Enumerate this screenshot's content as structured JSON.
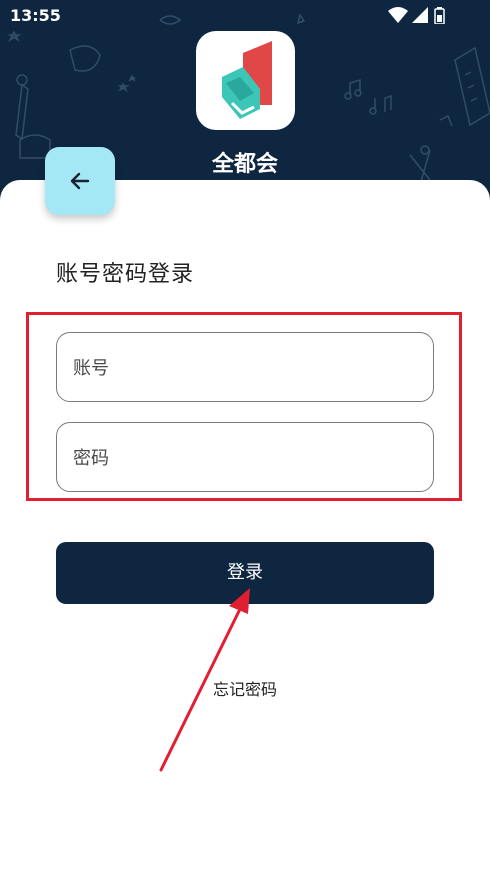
{
  "status_bar": {
    "time": "13:55"
  },
  "app": {
    "name": "全都会",
    "logo_icon": "book-flag-logo-icon"
  },
  "back_button": {
    "icon": "arrow-left-icon"
  },
  "login_form": {
    "title": "账号密码登录",
    "account_placeholder": "账号",
    "account_value": "",
    "password_placeholder": "密码",
    "password_value": "",
    "submit_label": "登录",
    "forgot_password_label": "忘记密码"
  },
  "colors": {
    "header_background": "#0e2640",
    "back_button_background": "#a4e7f5",
    "highlight_border": "#e02031",
    "annotation_arrow": "#e02031",
    "login_button": "#0e2640",
    "logo_red": "#e04848",
    "logo_teal": "#3cc6b8"
  }
}
